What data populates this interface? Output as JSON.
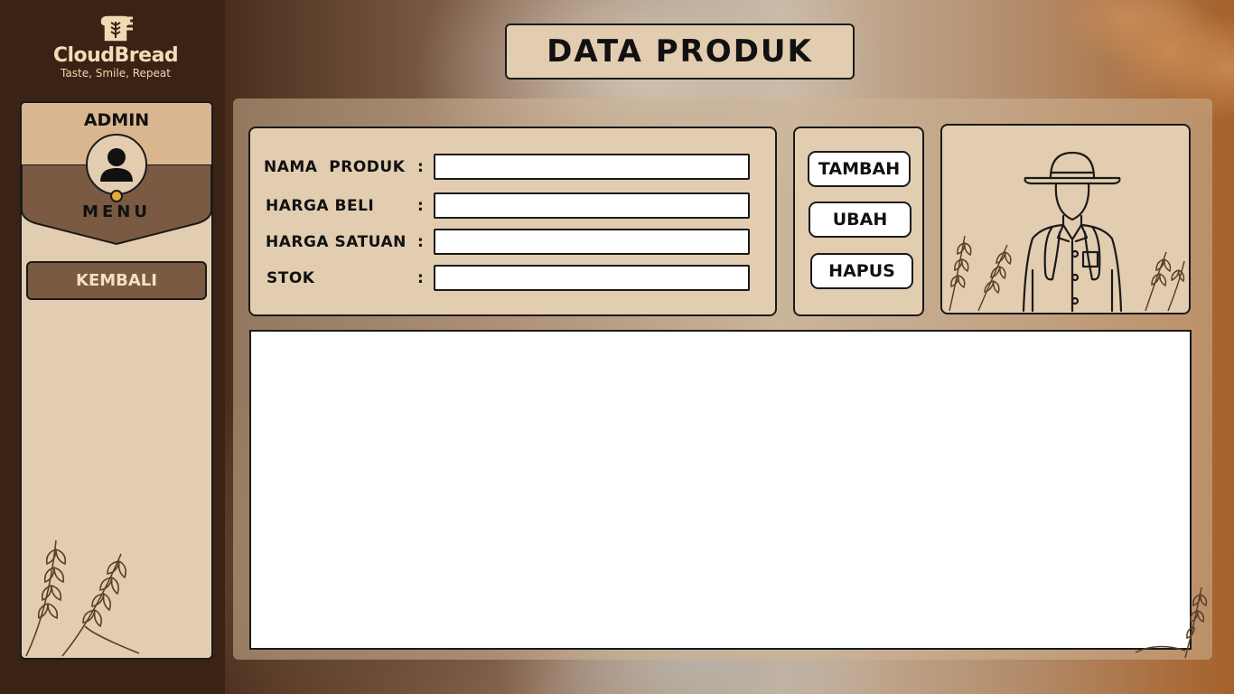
{
  "app": {
    "brand_name": "CloudBread",
    "brand_tagline": "Taste, Smile, Repeat"
  },
  "header": {
    "title": "DATA PRODUK"
  },
  "sidebar": {
    "role_label": "ADMIN",
    "menu_label": "MENU",
    "items": [
      {
        "label": "KEMBALI"
      }
    ]
  },
  "form": {
    "fields": [
      {
        "label": "NAMA  PRODUK",
        "colon": ":",
        "value": ""
      },
      {
        "label": "HARGA BELI",
        "colon": ":",
        "value": ""
      },
      {
        "label": "HARGA SATUAN",
        "colon": ":",
        "value": ""
      },
      {
        "label": "STOK",
        "colon": ":",
        "value": ""
      }
    ]
  },
  "actions": {
    "add_label": "TAMBAH",
    "edit_label": "UBAH",
    "delete_label": "HAPUS"
  },
  "colors": {
    "panel_beige": "#e3cdb0",
    "header_tan": "#dab690",
    "menu_brown": "#7a5a43",
    "dark_background": "#3a2315",
    "accent_orange": "#e8a93a"
  },
  "icons": {
    "logo": "bread-logo-icon",
    "avatar": "user-avatar-icon",
    "illustration": "farmer-illustration-icon",
    "decoration": "wheat-icon"
  }
}
